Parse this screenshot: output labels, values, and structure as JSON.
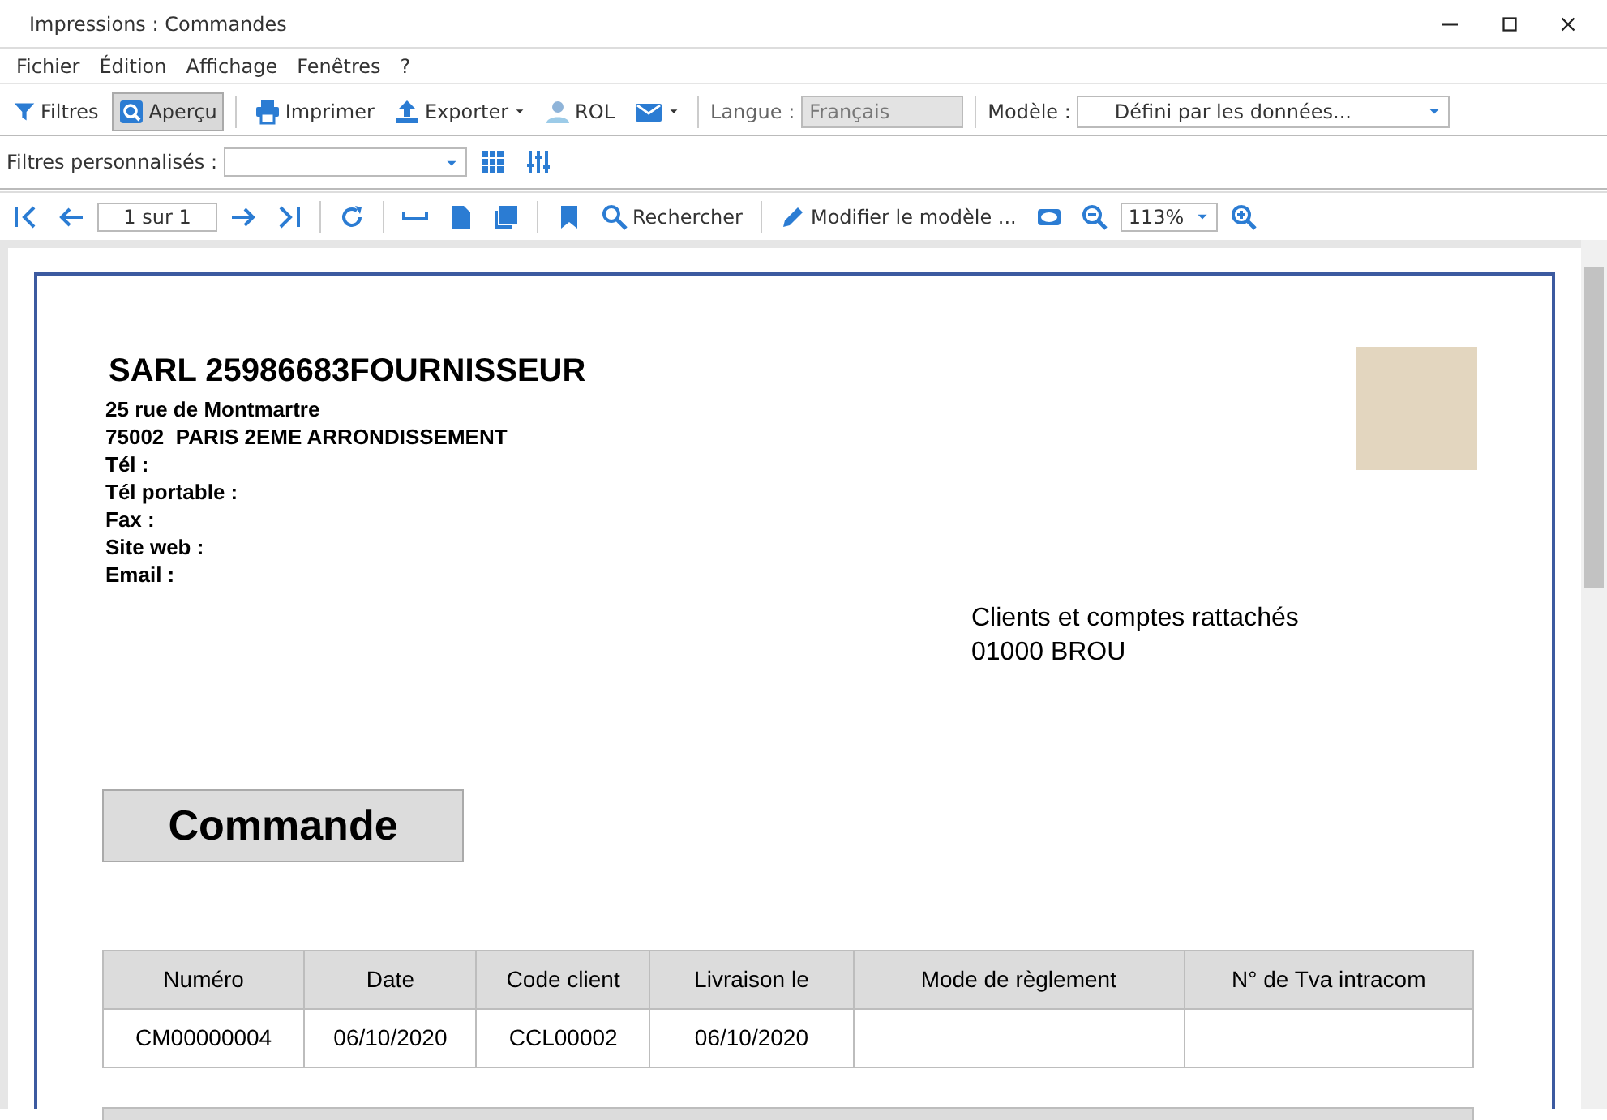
{
  "window": {
    "title": "Impressions : Commandes"
  },
  "menu": [
    "Fichier",
    "Édition",
    "Affichage",
    "Fenêtres",
    "?"
  ],
  "toolbar": {
    "filters": {
      "label": "Filtres",
      "selected": false
    },
    "preview": {
      "label": "Aperçu",
      "selected": true
    },
    "print": "Imprimer",
    "export": "Exporter",
    "rol": "ROL",
    "language_label": "Langue :",
    "language": "Français",
    "model_label": "Modèle :",
    "model": "Défini par les données..."
  },
  "custom_filters": {
    "label": "Filtres personnalisés :"
  },
  "preview_toolbar": {
    "page": "1 sur 1",
    "search": "Rechercher",
    "edit_model": "Modifier le modèle ...",
    "zoom": "113%"
  },
  "document": {
    "company": "SARL 25986683FOURNISSEUR",
    "address_lines": [
      "25 rue de Montmartre",
      "75002  PARIS 2EME ARRONDISSEMENT",
      "Tél :",
      "Tél portable :",
      "Fax :",
      "Site web :",
      "Email :"
    ],
    "recipient_lines": [
      "Clients et comptes rattachés",
      "01000 BROU"
    ],
    "heading": "Commande",
    "order_table": {
      "columns": [
        "Numéro",
        "Date",
        "Code client",
        "Livraison le",
        "Mode de règlement",
        "N° de Tva intracom"
      ],
      "rows": [
        [
          "CM00000004",
          "06/10/2020",
          "CCL00002",
          "06/10/2020",
          "",
          ""
        ]
      ]
    }
  }
}
